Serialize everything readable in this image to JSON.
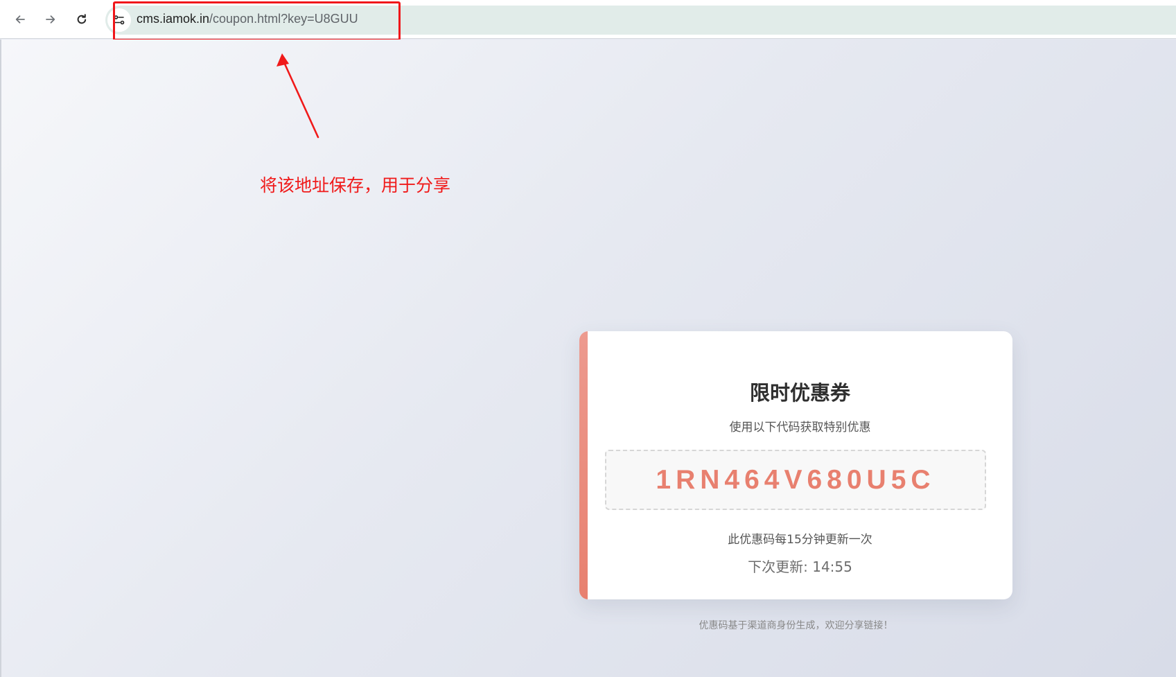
{
  "browser": {
    "url_host": "cms.iamok.in",
    "url_path": "/coupon.html?key=U8GUU",
    "back_icon": "arrow-left-icon",
    "forward_icon": "arrow-right-icon",
    "reload_icon": "reload-icon",
    "site_info_icon": "tune-icon"
  },
  "annotation": {
    "text": "将该地址保存，用于分享",
    "color": "#f01a1a"
  },
  "coupon": {
    "title": "限时优惠券",
    "subtitle": "使用以下代码获取特别优惠",
    "code": "1RN464V680U5C",
    "refresh_note": "此优惠码每15分钟更新一次",
    "next_update": "下次更新: 14:55",
    "accent_color": "#e8806f"
  },
  "footer": {
    "note": "优惠码基于渠道商身份生成，欢迎分享链接！"
  }
}
